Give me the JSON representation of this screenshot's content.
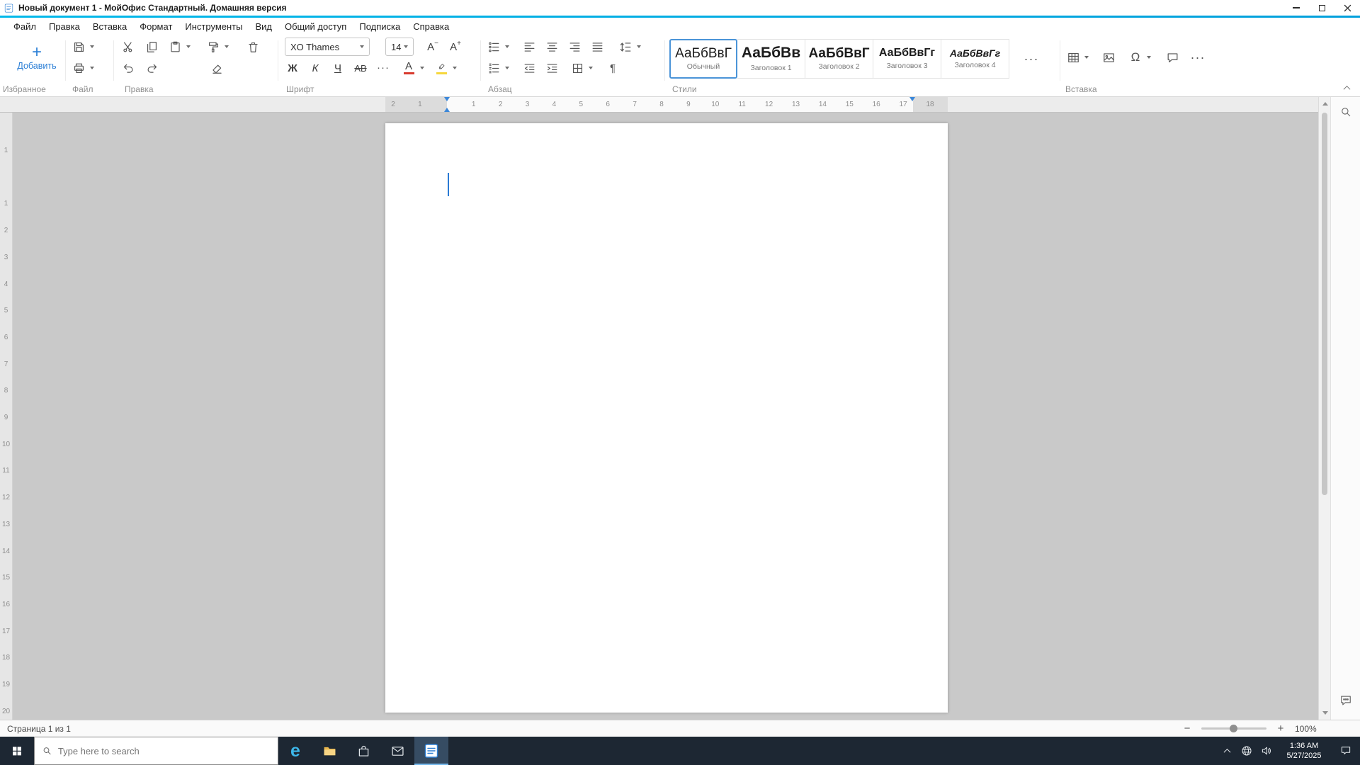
{
  "colors": {
    "accent_blue": "#2b7fd6",
    "accent_cyan": "#00b9ea",
    "font_color_bar": "#d83a2e",
    "highlight_bar": "#f6d73c"
  },
  "titlebar": {
    "title": "Новый документ 1 - МойОфис Стандартный. Домашняя версия"
  },
  "menubar": {
    "items": [
      "Файл",
      "Правка",
      "Вставка",
      "Формат",
      "Инструменты",
      "Вид",
      "Общий доступ",
      "Подписка",
      "Справка"
    ]
  },
  "toolbar": {
    "favorites": {
      "label": "Избранное",
      "add_label": "Добавить"
    },
    "file": {
      "label": "Файл"
    },
    "edit": {
      "label": "Правка"
    },
    "font": {
      "label": "Шрифт",
      "family_value": "XO Thames",
      "size_value": "14",
      "bold": "Ж",
      "italic": "К",
      "underline": "Ч",
      "strike": "АВ",
      "color_letter": "А",
      "grow_letter": "А",
      "shrink_letter": "А"
    },
    "paragraph": {
      "label": "Абзац"
    },
    "styles": {
      "label": "Стили",
      "items": [
        {
          "preview": "АаБбВвГ",
          "name": "Обычный"
        },
        {
          "preview": "АаБбВв",
          "name": "Заголовок 1"
        },
        {
          "preview": "АаБбВвГ",
          "name": "Заголовок 2"
        },
        {
          "preview": "АаБбВвГг",
          "name": "Заголовок 3"
        },
        {
          "preview": "АаБбВвГг",
          "name": "Заголовок 4"
        }
      ]
    },
    "insert": {
      "label": "Вставка"
    }
  },
  "glyphs": {
    "plus": "+",
    "minus": "−",
    "more": "···",
    "pilcrow": "¶",
    "omega": "Ω"
  },
  "ruler": {
    "horizontal": [
      "2",
      "1",
      "1",
      "2",
      "3",
      "4",
      "5",
      "6",
      "7",
      "8",
      "9",
      "10",
      "11",
      "12",
      "13",
      "14",
      "15",
      "16",
      "17",
      "18"
    ],
    "vertical": [
      "1",
      "1",
      "2",
      "3",
      "4",
      "5",
      "6",
      "7",
      "8",
      "9",
      "10",
      "11",
      "12",
      "13",
      "14",
      "15",
      "16",
      "17",
      "18",
      "19",
      "20"
    ]
  },
  "statusbar": {
    "page_info": "Страница 1 из 1",
    "zoom_level": "100%"
  },
  "taskbar": {
    "search_placeholder": "Type here to search",
    "time": "1:36 AM",
    "date": "5/27/2025",
    "edge_letter": "e"
  }
}
